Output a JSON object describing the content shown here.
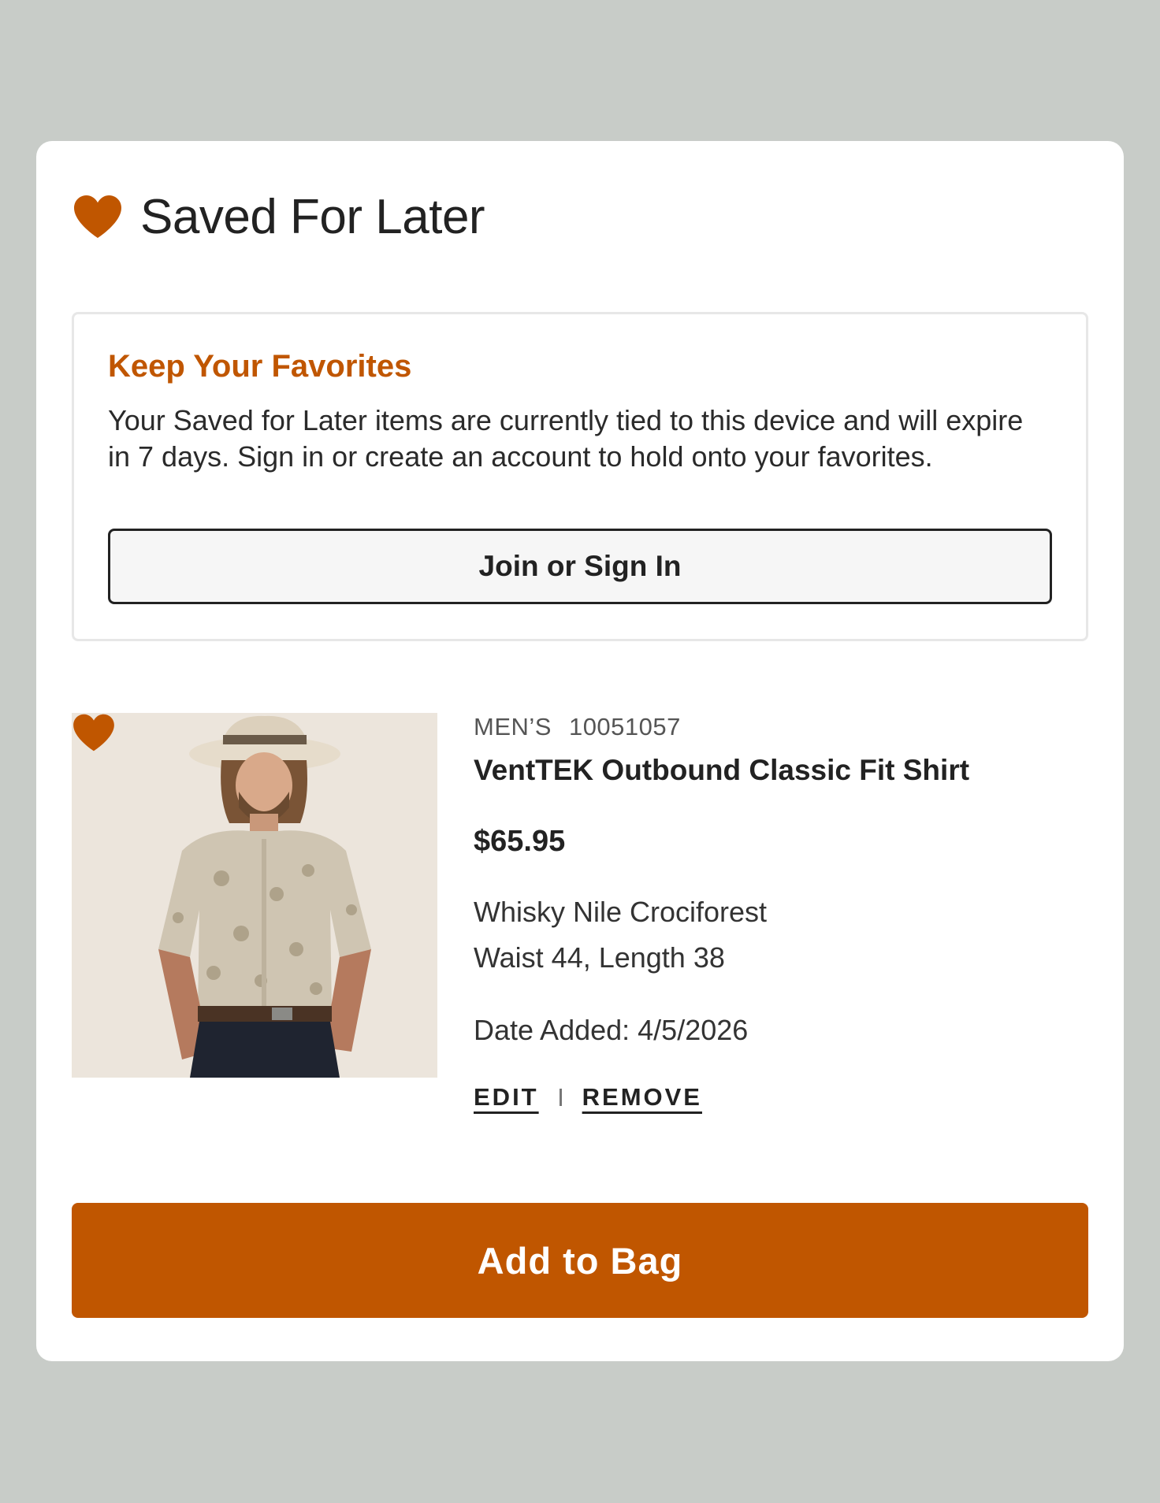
{
  "header": {
    "title": "Saved For Later",
    "icon": "heart-icon"
  },
  "notice": {
    "heading": "Keep Your Favorites",
    "body": "Your Saved for Later items are currently tied to this device and will expire in 7 days. Sign in or create an account to hold onto your favorites.",
    "button_label": "Join or Sign In"
  },
  "product": {
    "category": "MEN’S",
    "style_number": "10051057",
    "name": "VentTEK Outbound Classic Fit Shirt",
    "price": "$65.95",
    "color": "Whisky Nile Crociforest",
    "size": "Waist 44, Length 38",
    "date_added": "Date Added: 4/5/2026",
    "edit_label": "EDIT",
    "remove_label": "REMOVE"
  },
  "add_to_bag_label": "Add to Bag",
  "colors": {
    "accent": "#c05600",
    "background": "#c8ccc8",
    "card": "#ffffff"
  }
}
